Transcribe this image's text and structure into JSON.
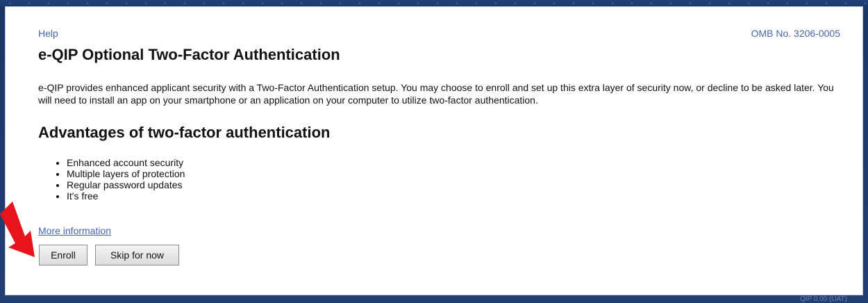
{
  "header": {
    "help_label": "Help",
    "omb_number": "OMB No. 3206-0005"
  },
  "main": {
    "title": "e-QIP Optional Two-Factor Authentication",
    "intro": "e-QIP provides enhanced applicant security with a Two-Factor Authentication setup. You may choose to enroll and set up this extra layer of security now, or decline to be asked later. You will need to install an app on your smartphone or an application on your computer to utilize two-factor authentication.",
    "advantages_title": "Advantages of two-factor authentication",
    "advantages": [
      "Enhanced account security",
      "Multiple layers of protection",
      "Regular password updates",
      "It's free"
    ],
    "more_info_label": "More information"
  },
  "actions": {
    "enroll_label": "Enroll",
    "skip_label": "Skip for now"
  },
  "footer": {
    "version_text": "QIP 0.00 (UAT)"
  },
  "colors": {
    "frame": "#1f3a6b",
    "link": "#4466b0",
    "arrow": "#e8141b"
  },
  "annotation": {
    "arrow_icon": "red-arrow-icon",
    "points_to": "enroll-button"
  }
}
